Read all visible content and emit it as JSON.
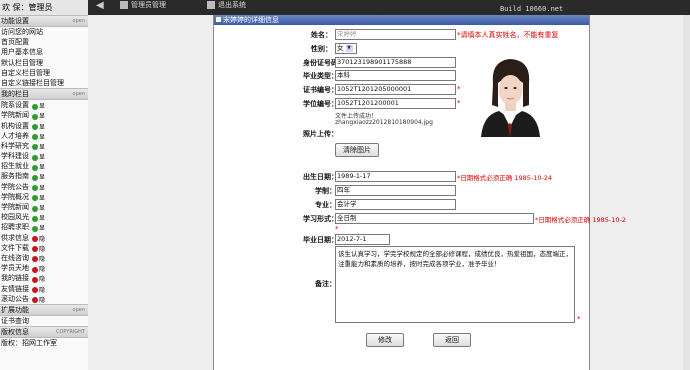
{
  "topbar": {
    "user_text": "欢  保：管理员",
    "admin_btn": "管理员管理",
    "exit_btn": "退出系统",
    "build": "Build 10660.net"
  },
  "sidebar": {
    "sec_func": "功能设置",
    "sec_func_open": "open",
    "func_items": [
      "访问您的网站",
      "首页配置",
      "用户基本信息",
      "默认栏目管理",
      "自定义栏目管理",
      "自定义链接栏目管理"
    ],
    "sec_my": "我的栏目",
    "sec_my_open": "open",
    "my_items": [
      {
        "name": "院系设置",
        "status": "显",
        "dot": "green"
      },
      {
        "name": "学院新闻",
        "status": "显",
        "dot": "green"
      },
      {
        "name": "机构设置",
        "status": "显",
        "dot": "green"
      },
      {
        "name": "人才培养",
        "status": "显",
        "dot": "green"
      },
      {
        "name": "科学研究",
        "status": "显",
        "dot": "green"
      },
      {
        "name": "学科建设",
        "status": "显",
        "dot": "green"
      },
      {
        "name": "招生就业",
        "status": "显",
        "dot": "green"
      },
      {
        "name": "服务指南",
        "status": "显",
        "dot": "green"
      },
      {
        "name": "学院公告",
        "status": "显",
        "dot": "green"
      },
      {
        "name": "学院概况",
        "status": "显",
        "dot": "green"
      },
      {
        "name": "学院新闻",
        "status": "显",
        "dot": "green"
      },
      {
        "name": "校园风光",
        "status": "显",
        "dot": "green"
      },
      {
        "name": "招聘求职",
        "status": "显",
        "dot": "green"
      },
      {
        "name": "供求信息",
        "status": "隐",
        "dot": "red"
      },
      {
        "name": "文件下载",
        "status": "隐",
        "dot": "red"
      },
      {
        "name": "在线咨询",
        "status": "隐",
        "dot": "red"
      },
      {
        "name": "学员天地",
        "status": "隐",
        "dot": "red"
      },
      {
        "name": "我的链接",
        "status": "隐",
        "dot": "red"
      },
      {
        "name": "友情链接",
        "status": "隐",
        "dot": "red"
      },
      {
        "name": "滚动公告",
        "status": "隐",
        "dot": "red"
      }
    ],
    "sec_ext": "扩展功能",
    "sec_ext_open": "open",
    "ext_items": [
      "证书查询"
    ],
    "sec_ver": "版权信息",
    "sec_ver_open": "COPYRIGHT",
    "ver_items": [
      "版权：招网工作室"
    ]
  },
  "panel": {
    "title": "宋婷婷的详细信息",
    "labels": {
      "name": "姓名：",
      "gender": "性别：",
      "idcard": "身份证号码：",
      "grad_type": "毕业类型：",
      "cert_no": "证书编号：",
      "degree_no": "学位编号：",
      "photo_upload": "照片上传：",
      "birthday": "出生日期：",
      "education": "学制：",
      "major": "专业：",
      "study_form": "学习形式：",
      "grad_date": "毕业日期：",
      "remarks": "备注："
    },
    "values": {
      "name": "宋婷婷",
      "gender": "女",
      "idcard": "370123198901175888",
      "grad_type": "本科",
      "cert_no": "1052T1201205000001",
      "degree_no": "1052T1201200001",
      "birthday": "1989-1-17",
      "education": "四年",
      "major": "会计学",
      "study_form": "全日制",
      "grad_date": "2012-7-1",
      "remarks": "该生认真学习，学完学校规定的全部必修课程，成绩优良，热爱祖国，态度端正，注重能力和素质的培养，按时完成各项学业，准予毕业！"
    },
    "hints": {
      "name": "*请填本人真实姓名，不能有重复",
      "date_format": "*日期格式必须正确 1985-10-24",
      "date_format_cut": "*日期格式必须正确 1985-10-2"
    },
    "upload_note": "文件上传成功！",
    "upload_file": "zhangxiaozz2012810180904.jpg",
    "clear_photo": "清除图片",
    "modify": "修改",
    "back": "返回"
  }
}
